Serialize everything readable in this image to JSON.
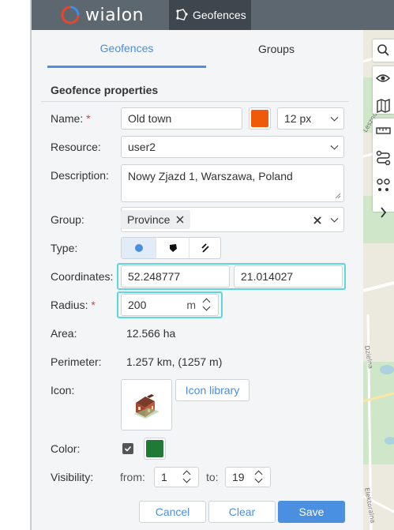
{
  "topbar": {
    "logo_text": "wialon",
    "active_tab": "Geofences"
  },
  "tabs": [
    {
      "label": "Geofences"
    },
    {
      "label": "Groups"
    }
  ],
  "section_title": "Geofence properties",
  "labels": {
    "name": "Name:",
    "resource": "Resource:",
    "description": "Description:",
    "group": "Group:",
    "type": "Type:",
    "coordinates": "Coordinates:",
    "radius": "Radius:",
    "area": "Area:",
    "perimeter": "Perimeter:",
    "icon": "Icon:",
    "color": "Color:",
    "visibility": "Visibility:",
    "required_mark": "*"
  },
  "form": {
    "name": "Old town",
    "name_color": "#f0580a",
    "line_width": "12 px",
    "resource": "user2",
    "description": "Nowy Zjazd 1, Warszawa, Poland",
    "group_chip": "Province",
    "latitude": "52.248777",
    "longitude": "21.014027",
    "radius": "200",
    "radius_unit": "m",
    "area": "12.566 ha",
    "perimeter": "1.257 km, (1257 m)",
    "icon_library": "Icon library",
    "color_checked": true,
    "color_value": "#1e7a35",
    "visibility_from_label": "from:",
    "visibility_from": "1",
    "visibility_to_label": "to:",
    "visibility_to": "19"
  },
  "type_options": [
    "circle",
    "polygon",
    "line"
  ],
  "type_selected": "circle",
  "buttons": {
    "cancel": "Cancel",
    "clear": "Clear",
    "save": "Save"
  },
  "colors": {
    "accent": "#4a8fe0",
    "highlight": "#5ed6dd",
    "topbar": "#5d6770"
  },
  "map_toolbar": [
    "search-icon",
    "eye-icon",
    "map-icon",
    "ruler-icon",
    "route-icon",
    "nearby-icon",
    "chevron-right-icon"
  ]
}
